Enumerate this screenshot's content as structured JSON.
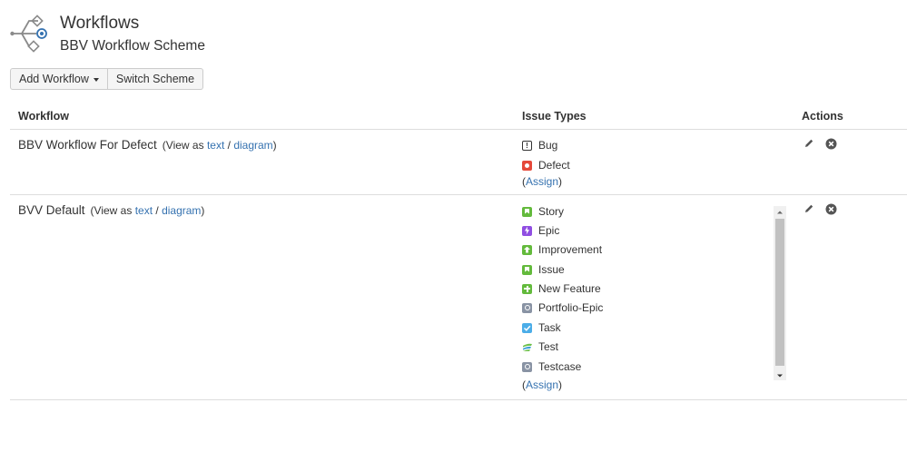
{
  "header": {
    "title": "Workflows",
    "subtitle": "BBV Workflow Scheme",
    "icon": "workflow-icon"
  },
  "toolbar": {
    "add_workflow_label": "Add Workflow",
    "switch_scheme_label": "Switch Scheme"
  },
  "table": {
    "columns": [
      "Workflow",
      "Issue Types",
      "Actions"
    ],
    "rows": [
      {
        "name": "BBV Workflow For Defect",
        "view_prefix": "(View as",
        "text_link": "text",
        "separator": "/",
        "diagram_link": "diagram",
        "view_suffix": ")",
        "issue_types": [
          {
            "label": "Bug",
            "icon": "bug-icon",
            "color": "#ffffff"
          },
          {
            "label": "Defect",
            "icon": "defect-icon",
            "color": "#e5493a"
          }
        ],
        "assign_prefix": "(",
        "assign_label": "Assign",
        "assign_suffix": ")"
      },
      {
        "name": "BVV Default",
        "view_prefix": "(View as",
        "text_link": "text",
        "separator": "/",
        "diagram_link": "diagram",
        "view_suffix": ")",
        "issue_types": [
          {
            "label": "Story",
            "icon": "story-icon",
            "color": "#63ba3c"
          },
          {
            "label": "Epic",
            "icon": "epic-icon",
            "color": "#904ee2"
          },
          {
            "label": "Improvement",
            "icon": "improvement-icon",
            "color": "#63ba3c"
          },
          {
            "label": "Issue",
            "icon": "issue-icon",
            "color": "#63ba3c"
          },
          {
            "label": "New Feature",
            "icon": "new-feature-icon",
            "color": "#63ba3c"
          },
          {
            "label": "Portfolio-Epic",
            "icon": "portfolio-epic-icon",
            "color": "#8993a4"
          },
          {
            "label": "Task",
            "icon": "task-icon",
            "color": "#4bade8"
          },
          {
            "label": "Test",
            "icon": "test-icon",
            "color": "#6cc04a"
          },
          {
            "label": "Testcase",
            "icon": "testcase-icon",
            "color": "#8993a4"
          }
        ],
        "assign_prefix": "(",
        "assign_label": "Assign",
        "assign_suffix": ")"
      }
    ]
  },
  "actions": {
    "edit_icon": "pencil-icon",
    "delete_icon": "remove-icon"
  }
}
